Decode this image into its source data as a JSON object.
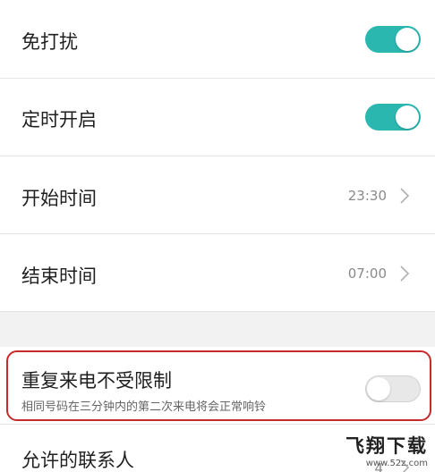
{
  "settings": {
    "dnd": {
      "label": "免打扰",
      "enabled": true
    },
    "scheduled": {
      "label": "定时开启",
      "enabled": true
    },
    "start_time": {
      "label": "开始时间",
      "value": "23:30"
    },
    "end_time": {
      "label": "结束时间",
      "value": "07:00"
    },
    "repeat_calls": {
      "label": "重复来电不受限制",
      "description": "相同号码在三分钟内的第二次来电将会正常响铃",
      "enabled": false
    },
    "allowed_contacts": {
      "label": "允许的联系人",
      "value": "4"
    }
  },
  "colors": {
    "accent": "#2ab7b0",
    "highlight": "#c62a2a"
  },
  "watermark": {
    "main": "飞翔下载",
    "sub": "www.52z.com"
  }
}
